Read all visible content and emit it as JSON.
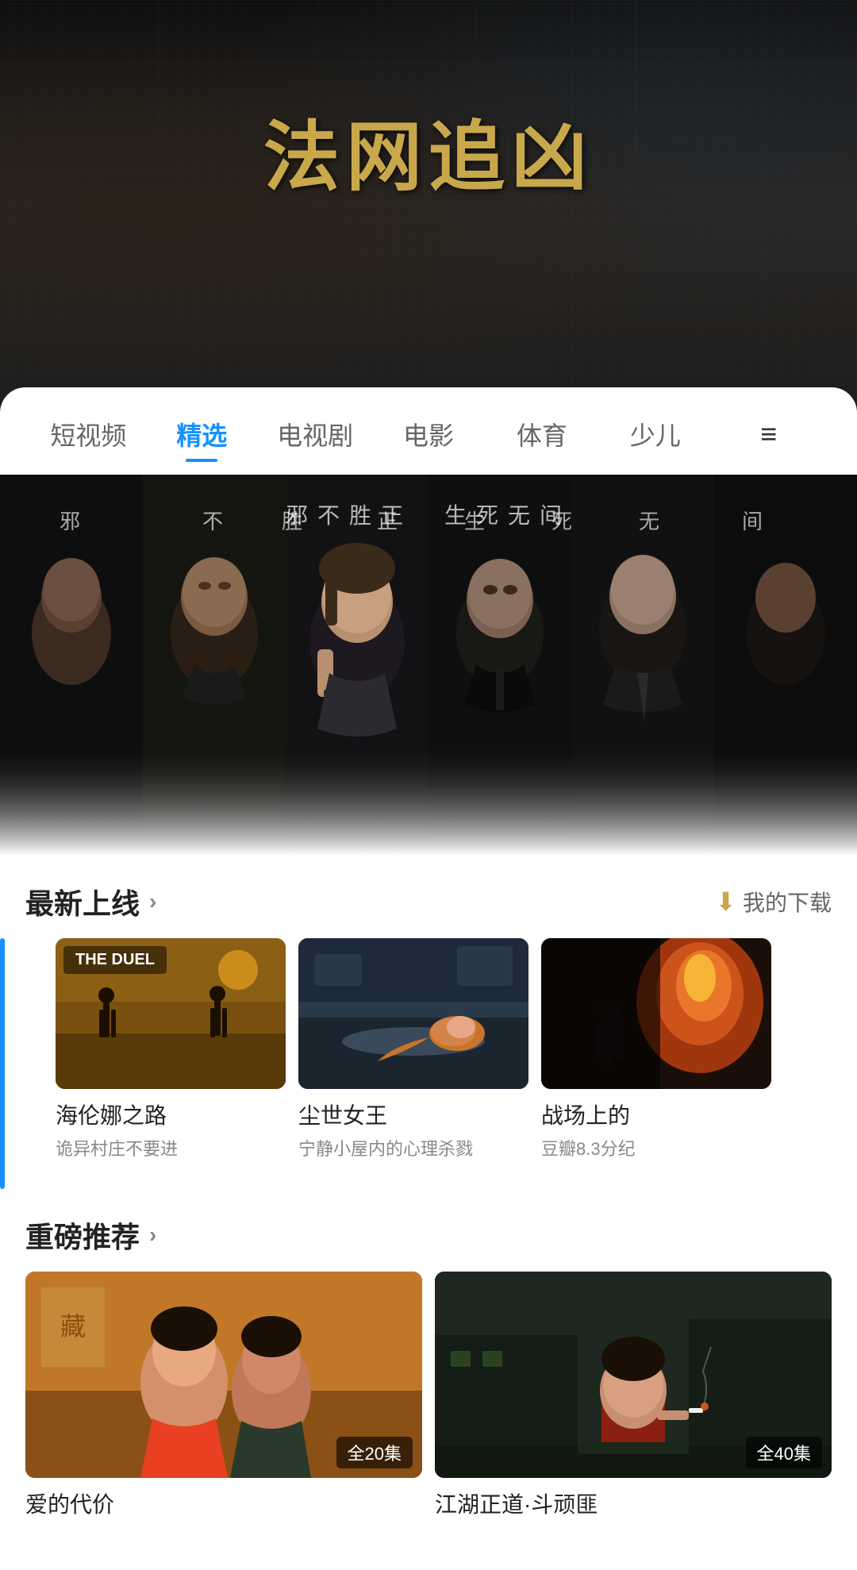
{
  "hero": {
    "title": "法网追凶",
    "bg_color": "#1a1a1a"
  },
  "nav": {
    "tabs": [
      {
        "id": "short",
        "label": "短视频",
        "active": false
      },
      {
        "id": "featured",
        "label": "精选",
        "active": true
      },
      {
        "id": "tv",
        "label": "电视剧",
        "active": false
      },
      {
        "id": "movie",
        "label": "电影",
        "active": false
      },
      {
        "id": "sports",
        "label": "体育",
        "active": false
      },
      {
        "id": "kids",
        "label": "少儿",
        "active": false
      },
      {
        "id": "more",
        "label": "≡",
        "active": false
      }
    ]
  },
  "banner": {
    "text_left": "邪不胜正",
    "text_right": "生死无间",
    "chars": [
      "邪",
      "不",
      "胜",
      "正",
      "生",
      "死",
      "无",
      "间"
    ]
  },
  "sections": {
    "latest": {
      "title": "最新上线",
      "arrow": "›",
      "download": "我的下载"
    },
    "recommend": {
      "title": "重磅推荐",
      "arrow": "›"
    }
  },
  "latest_movies": [
    {
      "id": "duel",
      "title": "海伦娜之路",
      "subtitle": "诡异村庄不要进",
      "thumb_label": "THE DUEL",
      "thumb_type": "duel"
    },
    {
      "id": "queen",
      "title": "尘世女王",
      "subtitle": "宁静小屋内的心理杀戮",
      "thumb_label": "",
      "thumb_type": "queen"
    },
    {
      "id": "battle",
      "title": "战场上的",
      "subtitle": "豆瓣8.3分纪",
      "thumb_label": "",
      "thumb_type": "battle"
    }
  ],
  "recommend_movies": [
    {
      "id": "love",
      "title": "爱的代价",
      "episode": "全20集",
      "thumb_type": "love"
    },
    {
      "id": "jihu",
      "title": "江湖正道·斗顽匪",
      "episode": "全40集",
      "thumb_type": "jihu"
    }
  ],
  "colors": {
    "accent_blue": "#1890ff",
    "accent_gold": "#c9a84c",
    "text_primary": "#222222",
    "text_secondary": "#888888"
  }
}
